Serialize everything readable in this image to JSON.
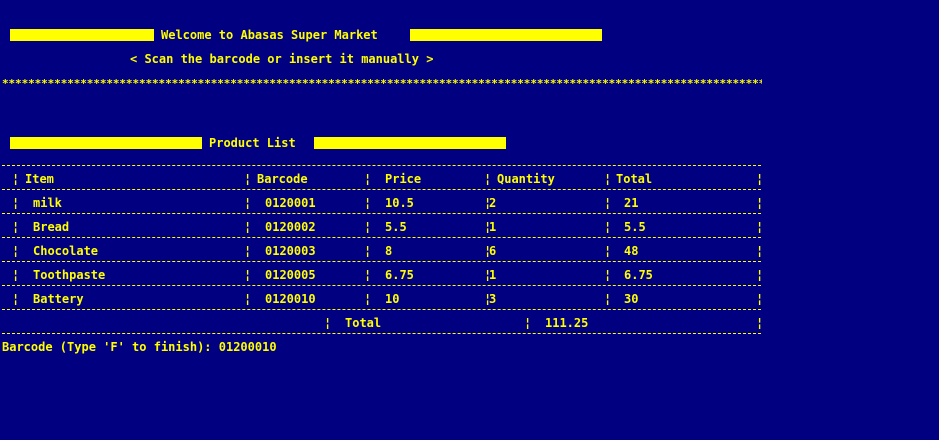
{
  "header": {
    "welcome": "Welcome to Abasas Super Market",
    "instruction": "< Scan the barcode or insert it manually >",
    "stars": "*************************************************************************************************************************************************************"
  },
  "product_list": {
    "title": "Product List",
    "columns": [
      "Item",
      "Barcode",
      "Price",
      "Quantity",
      "Total"
    ],
    "rows": [
      {
        "item": "milk",
        "barcode": "0120001",
        "price": "10.5",
        "quantity": "2",
        "total": "21"
      },
      {
        "item": "Bread",
        "barcode": "0120002",
        "price": "5.5",
        "quantity": "1",
        "total": "5.5"
      },
      {
        "item": "Chocolate",
        "barcode": "0120003",
        "price": "8",
        "quantity": "6",
        "total": "48"
      },
      {
        "item": "Toothpaste",
        "barcode": "0120005",
        "price": "6.75",
        "quantity": "1",
        "total": "6.75"
      },
      {
        "item": "Battery",
        "barcode": "0120010",
        "price": "10",
        "quantity": "3",
        "total": "30"
      }
    ],
    "total_label": "Total",
    "total_value": "111.25"
  },
  "prompt": {
    "label": "Barcode (Type 'F' to finish): ",
    "value": "01200010"
  },
  "colors": {
    "background": "#000080",
    "foreground": "#ffff00"
  }
}
